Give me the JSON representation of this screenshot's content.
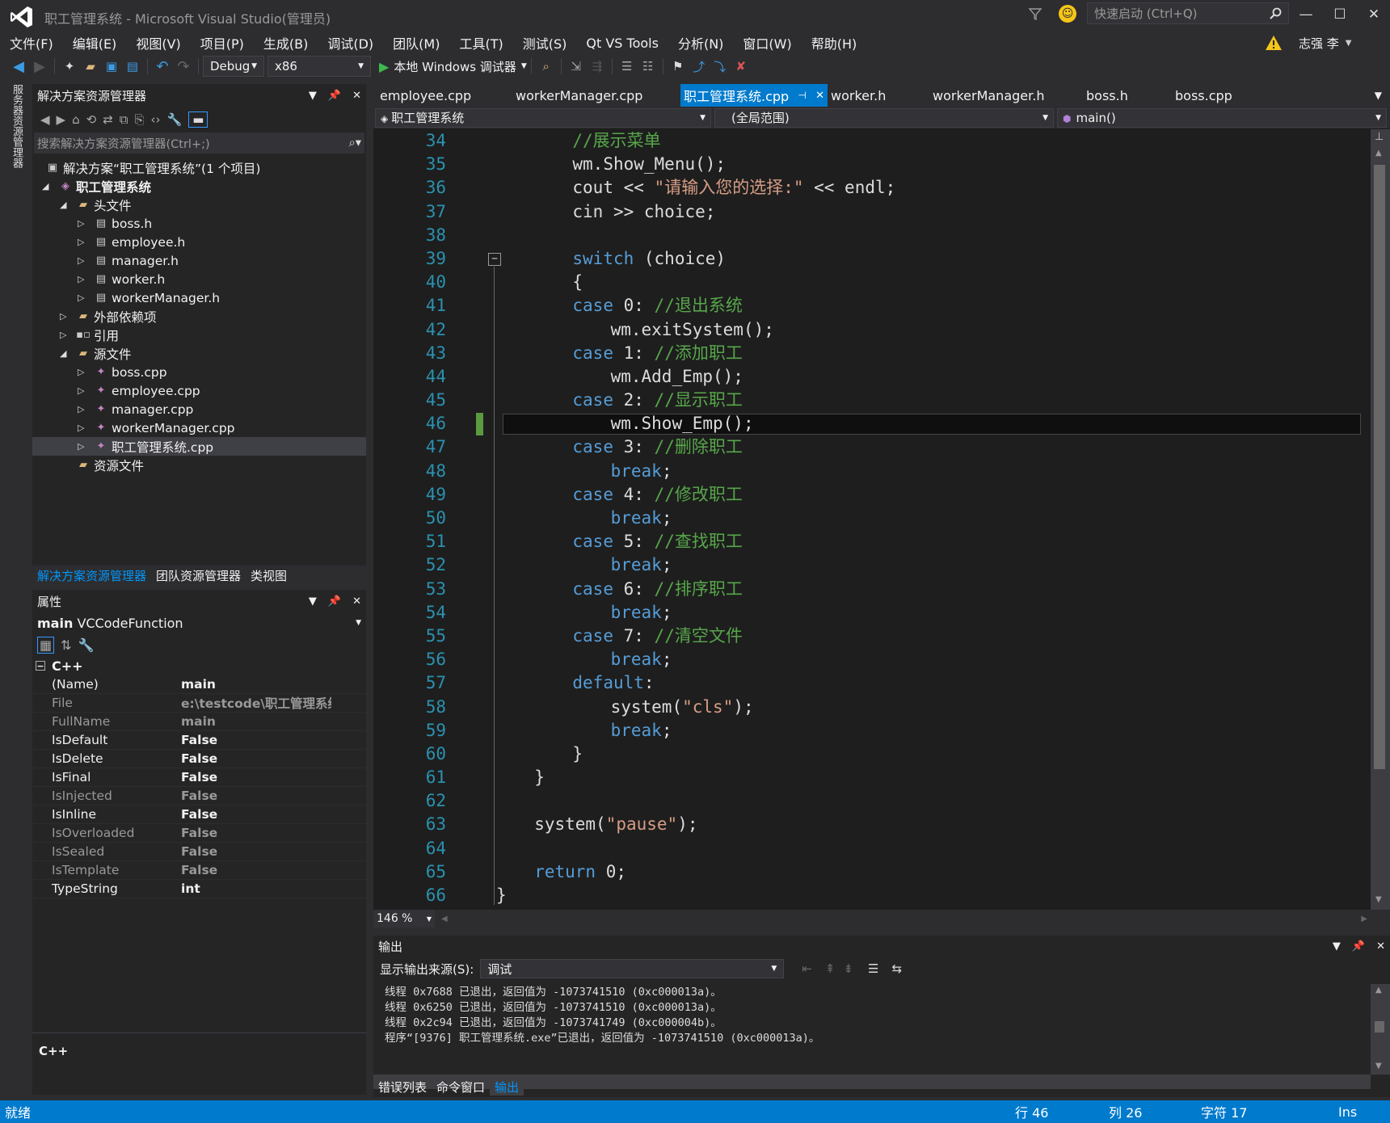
{
  "window": {
    "title": "职工管理系统 - Microsoft Visual Studio(管理员)",
    "quick_launch_placeholder": "快速启动 (Ctrl+Q)",
    "user": "志强 李"
  },
  "menu": [
    "文件(F)",
    "编辑(E)",
    "视图(V)",
    "项目(P)",
    "生成(B)",
    "调试(D)",
    "团队(M)",
    "工具(T)",
    "测试(S)",
    "Qt VS Tools",
    "分析(N)",
    "窗口(W)",
    "帮助(H)"
  ],
  "toolbar": {
    "config": "Debug",
    "platform": "x86",
    "run_label": "本地 Windows 调试器"
  },
  "side_strip": {
    "server_explorer": "服务器资源管理器"
  },
  "solution_explorer": {
    "title": "解决方案资源管理器",
    "search_placeholder": "搜索解决方案资源管理器(Ctrl+;)",
    "solution": "解决方案“职工管理系统”(1 个项目)",
    "project": "职工管理系统",
    "headers_folder": "头文件",
    "headers": [
      "boss.h",
      "employee.h",
      "manager.h",
      "worker.h",
      "workerManager.h"
    ],
    "external_deps": "外部依赖项",
    "references": "引用",
    "sources_folder": "源文件",
    "sources": [
      "boss.cpp",
      "employee.cpp",
      "manager.cpp",
      "workerManager.cpp",
      "职工管理系统.cpp"
    ],
    "resources_folder": "资源文件",
    "bottom_tabs": [
      "解决方案资源管理器",
      "团队资源管理器",
      "类视图"
    ]
  },
  "properties": {
    "title": "属性",
    "object": "main",
    "object_type": "VCCodeFunction",
    "category": "C++",
    "rows": [
      {
        "name": "(Name)",
        "value": "main",
        "dim": false
      },
      {
        "name": "File",
        "value": "e:\\testcode\\职工管理系统\\职工",
        "dim": true
      },
      {
        "name": "FullName",
        "value": "main",
        "dim": true
      },
      {
        "name": "IsDefault",
        "value": "False",
        "dim": false
      },
      {
        "name": "IsDelete",
        "value": "False",
        "dim": false
      },
      {
        "name": "IsFinal",
        "value": "False",
        "dim": false
      },
      {
        "name": "IsInjected",
        "value": "False",
        "dim": true
      },
      {
        "name": "IsInline",
        "value": "False",
        "dim": false
      },
      {
        "name": "IsOverloaded",
        "value": "False",
        "dim": true
      },
      {
        "name": "IsSealed",
        "value": "False",
        "dim": true
      },
      {
        "name": "IsTemplate",
        "value": "False",
        "dim": true
      },
      {
        "name": "TypeString",
        "value": "int",
        "dim": false
      }
    ],
    "description_title": "C++"
  },
  "doc_tabs": [
    {
      "label": "employee.cpp",
      "active": false
    },
    {
      "label": "workerManager.cpp",
      "active": false
    },
    {
      "label": "职工管理系统.cpp",
      "active": true
    },
    {
      "label": "worker.h",
      "active": false
    },
    {
      "label": "workerManager.h",
      "active": false
    },
    {
      "label": "boss.h",
      "active": false
    },
    {
      "label": "boss.cpp",
      "active": false
    }
  ],
  "nav": {
    "project": "职工管理系统",
    "scope": "(全局范围)",
    "member": "main()"
  },
  "code_lines": [
    {
      "n": "34",
      "indent": 8,
      "parts": [
        [
          "cm",
          "//展示菜单"
        ]
      ]
    },
    {
      "n": "35",
      "indent": 8,
      "parts": [
        [
          "",
          "wm.Show_Menu();"
        ]
      ]
    },
    {
      "n": "36",
      "indent": 8,
      "parts": [
        [
          "",
          "cout << "
        ],
        [
          "st",
          "\"请输入您的选择:\""
        ],
        [
          "",
          " << endl;"
        ]
      ]
    },
    {
      "n": "37",
      "indent": 8,
      "parts": [
        [
          "",
          "cin >> choice;"
        ]
      ]
    },
    {
      "n": "38",
      "indent": 0,
      "parts": []
    },
    {
      "n": "39",
      "indent": 8,
      "parts": [
        [
          "kw",
          "switch"
        ],
        [
          "",
          " (choice)"
        ]
      ]
    },
    {
      "n": "40",
      "indent": 8,
      "parts": [
        [
          "",
          "{"
        ]
      ]
    },
    {
      "n": "41",
      "indent": 8,
      "parts": [
        [
          "kw",
          "case"
        ],
        [
          "",
          " 0: "
        ],
        [
          "cm",
          "//退出系统"
        ]
      ]
    },
    {
      "n": "42",
      "indent": 12,
      "parts": [
        [
          "",
          "wm.exitSystem();"
        ]
      ]
    },
    {
      "n": "43",
      "indent": 8,
      "parts": [
        [
          "kw",
          "case"
        ],
        [
          "",
          " 1: "
        ],
        [
          "cm",
          "//添加职工"
        ]
      ]
    },
    {
      "n": "44",
      "indent": 12,
      "parts": [
        [
          "",
          "wm.Add_Emp();"
        ]
      ]
    },
    {
      "n": "45",
      "indent": 8,
      "parts": [
        [
          "kw",
          "case"
        ],
        [
          "",
          " 2: "
        ],
        [
          "cm",
          "//显示职工"
        ]
      ]
    },
    {
      "n": "46",
      "indent": 12,
      "parts": [
        [
          "",
          "wm.Show_Emp();"
        ]
      ]
    },
    {
      "n": "47",
      "indent": 8,
      "parts": [
        [
          "kw",
          "case"
        ],
        [
          "",
          " 3: "
        ],
        [
          "cm",
          "//删除职工"
        ]
      ]
    },
    {
      "n": "48",
      "indent": 12,
      "parts": [
        [
          "kw",
          "break"
        ],
        [
          "",
          ";"
        ]
      ]
    },
    {
      "n": "49",
      "indent": 8,
      "parts": [
        [
          "kw",
          "case"
        ],
        [
          "",
          " 4: "
        ],
        [
          "cm",
          "//修改职工"
        ]
      ]
    },
    {
      "n": "50",
      "indent": 12,
      "parts": [
        [
          "kw",
          "break"
        ],
        [
          "",
          ";"
        ]
      ]
    },
    {
      "n": "51",
      "indent": 8,
      "parts": [
        [
          "kw",
          "case"
        ],
        [
          "",
          " 5: "
        ],
        [
          "cm",
          "//查找职工"
        ]
      ]
    },
    {
      "n": "52",
      "indent": 12,
      "parts": [
        [
          "kw",
          "break"
        ],
        [
          "",
          ";"
        ]
      ]
    },
    {
      "n": "53",
      "indent": 8,
      "parts": [
        [
          "kw",
          "case"
        ],
        [
          "",
          " 6: "
        ],
        [
          "cm",
          "//排序职工"
        ]
      ]
    },
    {
      "n": "54",
      "indent": 12,
      "parts": [
        [
          "kw",
          "break"
        ],
        [
          "",
          ";"
        ]
      ]
    },
    {
      "n": "55",
      "indent": 8,
      "parts": [
        [
          "kw",
          "case"
        ],
        [
          "",
          " 7: "
        ],
        [
          "cm",
          "//清空文件"
        ]
      ]
    },
    {
      "n": "56",
      "indent": 12,
      "parts": [
        [
          "kw",
          "break"
        ],
        [
          "",
          ";"
        ]
      ]
    },
    {
      "n": "57",
      "indent": 8,
      "parts": [
        [
          "kw",
          "default"
        ],
        [
          "",
          ":"
        ]
      ]
    },
    {
      "n": "58",
      "indent": 12,
      "parts": [
        [
          "",
          "system("
        ],
        [
          "st",
          "\"cls\""
        ],
        [
          "",
          ");"
        ]
      ]
    },
    {
      "n": "59",
      "indent": 12,
      "parts": [
        [
          "kw",
          "break"
        ],
        [
          "",
          ";"
        ]
      ]
    },
    {
      "n": "60",
      "indent": 8,
      "parts": [
        [
          "",
          "}"
        ]
      ]
    },
    {
      "n": "61",
      "indent": 4,
      "parts": [
        [
          "",
          "}"
        ]
      ]
    },
    {
      "n": "62",
      "indent": 0,
      "parts": []
    },
    {
      "n": "63",
      "indent": 4,
      "parts": [
        [
          "",
          "system("
        ],
        [
          "st",
          "\"pause\""
        ],
        [
          "",
          ");"
        ]
      ]
    },
    {
      "n": "64",
      "indent": 0,
      "parts": []
    },
    {
      "n": "65",
      "indent": 4,
      "parts": [
        [
          "kw",
          "return"
        ],
        [
          "",
          " 0;"
        ]
      ]
    },
    {
      "n": "66",
      "indent": 0,
      "parts": [
        [
          "",
          "}"
        ]
      ]
    }
  ],
  "current_line": "46",
  "zoom": "146 %",
  "output": {
    "title": "输出",
    "source_label": "显示输出来源(S):",
    "source_value": "调试",
    "lines": [
      "线程 0x7688 已退出，返回值为 -1073741510 (0xc000013a)。",
      "线程 0x6250 已退出，返回值为 -1073741510 (0xc000013a)。",
      "线程 0x2c94 已退出，返回值为 -1073741749 (0xc000004b)。",
      "程序“[9376] 职工管理系统.exe”已退出，返回值为 -1073741510 (0xc000013a)。"
    ],
    "bottom_tabs": [
      {
        "label": "错误列表",
        "active": false
      },
      {
        "label": "命令窗口",
        "active": false
      },
      {
        "label": "输出",
        "active": true
      }
    ]
  },
  "status": {
    "state": "就绪",
    "line": "行 46",
    "col": "列 26",
    "char": "字符 17",
    "mode": "Ins"
  },
  "colors": {
    "accent": "#007acc",
    "keyword": "#569cd6",
    "comment": "#57a64a",
    "string": "#d69d85",
    "line_number": "#2b91af"
  }
}
